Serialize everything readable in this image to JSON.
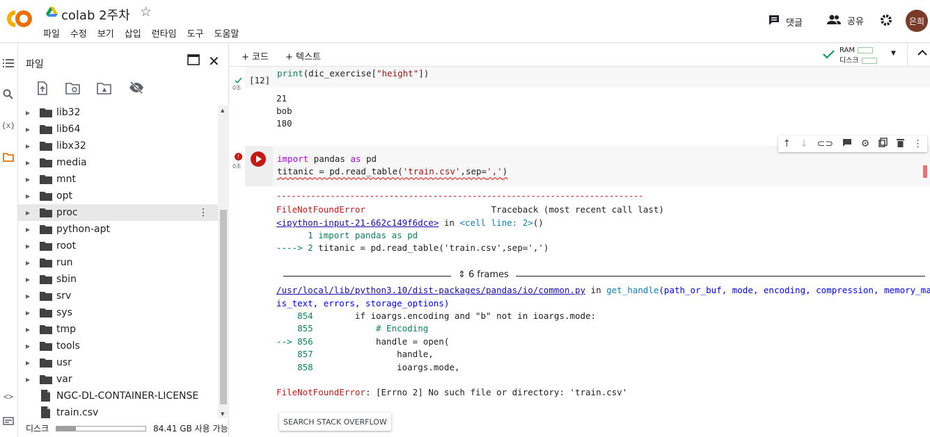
{
  "header": {
    "logo_text": "CO",
    "title": "colab 2주차",
    "menu": [
      "파일",
      "수정",
      "보기",
      "삽입",
      "런타임",
      "도구",
      "도움말"
    ],
    "comment_label": "댓글",
    "share_label": "공유",
    "avatar_text": "은희"
  },
  "panel": {
    "title": "파일",
    "items": [
      {
        "name": "lib32",
        "type": "folder"
      },
      {
        "name": "lib64",
        "type": "folder"
      },
      {
        "name": "libx32",
        "type": "folder"
      },
      {
        "name": "media",
        "type": "folder"
      },
      {
        "name": "mnt",
        "type": "folder"
      },
      {
        "name": "opt",
        "type": "folder"
      },
      {
        "name": "proc",
        "type": "folder",
        "selected": true
      },
      {
        "name": "python-apt",
        "type": "folder"
      },
      {
        "name": "root",
        "type": "folder"
      },
      {
        "name": "run",
        "type": "folder"
      },
      {
        "name": "sbin",
        "type": "folder"
      },
      {
        "name": "srv",
        "type": "folder"
      },
      {
        "name": "sys",
        "type": "folder"
      },
      {
        "name": "tmp",
        "type": "folder"
      },
      {
        "name": "tools",
        "type": "folder"
      },
      {
        "name": "usr",
        "type": "folder"
      },
      {
        "name": "var",
        "type": "folder"
      },
      {
        "name": "NGC-DL-CONTAINER-LICENSE",
        "type": "file"
      },
      {
        "name": "train.csv",
        "type": "file"
      }
    ],
    "disk_label": "디스크",
    "disk_free": "84.41 GB 사용 가능",
    "disk_used_fraction": 0.22
  },
  "toolbar": {
    "code_label": "+ 코드",
    "text_label": "+ 텍스트",
    "ram_label": "RAM",
    "disk_label": "디스크"
  },
  "cell1": {
    "exec_count": "[12]",
    "time": "0초",
    "code_fn": "print",
    "code_open": "(dic_exercise[",
    "code_str": "\"height\"",
    "code_close": "])",
    "outputs": [
      "21",
      "bob",
      "180"
    ]
  },
  "cell2": {
    "time": "0초",
    "line1_kw1": "import",
    "line1_mid": " pandas ",
    "line1_kw2": "as",
    "line1_end": " pd",
    "line2_start": "titanic = pd.read_table(",
    "line2_str1": "'train.csv'",
    "line2_mid": ",sep=",
    "line2_str2": "','",
    "line2_end": ")"
  },
  "error": {
    "dashes": "---------------------------------------------------------------------------",
    "err_name": "FileNotFoundError",
    "traceback_label": "                        Traceback (most recent call last)",
    "input_link": "<ipython-input-21-662c149f6dce>",
    "in_word": " in ",
    "cell_line": "<cell line: 2>",
    "parens": "()",
    "tb_line1": "      1 import pandas as pd",
    "tb_arrow": "----> 2 ",
    "tb_line2": "titanic = pd.read_table('train.csv',sep=',')",
    "frames_label": "6 frames",
    "path_link": "/usr/local/lib/python3.10/dist-packages/pandas/io/common.py",
    "get_handle": "get_handle",
    "args1": "(path_or_buf, mode, encoding, compression, memory_map,",
    "args2": "is_text, errors, storage_options)",
    "src": [
      {
        "num": "    854",
        "code": "        if ioargs.encoding and \"b\" not in ioargs.mode:"
      },
      {
        "num": "    855",
        "code": "            # Encoding"
      },
      {
        "num": "--> 856",
        "code": "            handle = open("
      },
      {
        "num": "    857",
        "code": "                handle,"
      },
      {
        "num": "    858",
        "code": "                ioargs.mode,"
      }
    ],
    "final_name": "FileNotFoundError",
    "final_msg": ": [Errno 2] No such file or directory: 'train.csv'",
    "so_button": "SEARCH STACK OVERFLOW"
  },
  "colors": {
    "accent_orange": "#f9ab00",
    "error_red": "#c41a16",
    "success_green": "#0f9d58"
  }
}
